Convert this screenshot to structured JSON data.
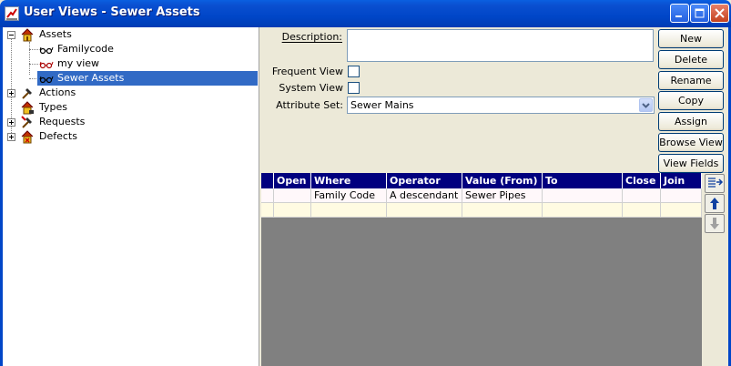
{
  "window": {
    "title": "User Views - Sewer Assets"
  },
  "tree": {
    "nodes": [
      {
        "label": "Assets",
        "icon": "house-icon"
      },
      {
        "label": "Familycode",
        "icon": "glasses-icon"
      },
      {
        "label": "my view",
        "icon": "glasses-icon"
      },
      {
        "label": "Sewer Assets",
        "icon": "glasses-icon",
        "selected": true
      },
      {
        "label": "Actions",
        "icon": "hammer-icon"
      },
      {
        "label": "Types",
        "icon": "house-icon"
      },
      {
        "label": "Requests",
        "icon": "hammer-icon"
      },
      {
        "label": "Defects",
        "icon": "house-icon"
      }
    ]
  },
  "form": {
    "description_label": "Description:",
    "description_value": "",
    "frequent_view_label": "Frequent View",
    "frequent_view_checked": false,
    "system_view_label": "System View",
    "system_view_checked": false,
    "attribute_set_label": "Attribute Set:",
    "attribute_set_value": "Sewer Mains"
  },
  "buttons": {
    "new": "New",
    "delete": "Delete",
    "rename": "Rename",
    "copy": "Copy",
    "assign": "Assign",
    "browse_view": "Browse View",
    "view_fields": "View Fields"
  },
  "grid": {
    "columns": [
      "Open",
      "Where",
      "Operator",
      "Value (From)",
      "To",
      "Close",
      "Join"
    ],
    "rows": [
      [
        "",
        "Family Code",
        "A descendant of",
        "Sewer Pipes",
        "",
        "",
        ""
      ]
    ]
  },
  "colors": {
    "titlebar": "#0046c8",
    "selection": "#316ac5",
    "grid_header": "#00007f"
  }
}
